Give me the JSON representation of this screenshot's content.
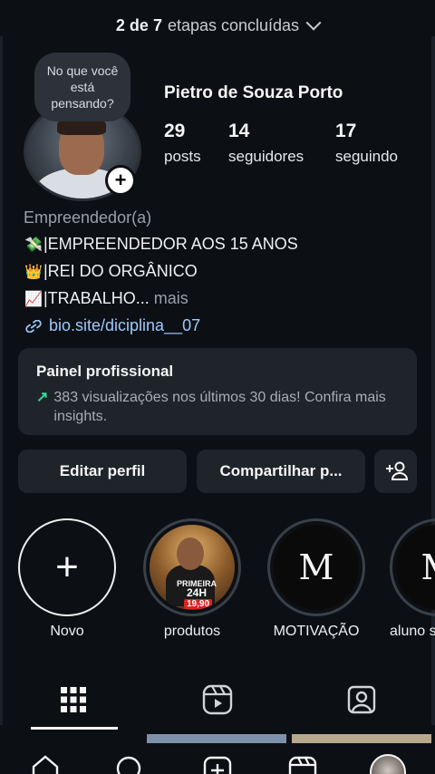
{
  "progress": {
    "done": "2 de 7",
    "rest": "etapas concluídas"
  },
  "profile": {
    "note_bubble": "No que você está pensando?",
    "name": "Pietro de Souza Porto",
    "stats": [
      {
        "value": "29",
        "label": "posts"
      },
      {
        "value": "14",
        "label": "seguidores"
      },
      {
        "value": "17",
        "label": "seguindo"
      }
    ],
    "category": "Empreendedor(a)",
    "bio_lines": [
      {
        "emoji": "💸",
        "text": "|EMPREENDEDOR AOS 15 ANOS"
      },
      {
        "emoji": "👑",
        "text": "|REI DO ORGÂNICO"
      },
      {
        "emoji": "📈",
        "text": "|TRABALHO..."
      }
    ],
    "more": "mais",
    "link": "bio.site/diciplina__07"
  },
  "panel": {
    "title": "Painel profissional",
    "description": "383 visualizações nos últimos 30 dias! Confira mais insights."
  },
  "buttons": {
    "edit": "Editar perfil",
    "share": "Compartilhar p..."
  },
  "highlights": [
    {
      "label": "Novo"
    },
    {
      "label": "produtos",
      "promo_top": "PRIMEIRA",
      "promo_mid": "24H",
      "price": "19,90"
    },
    {
      "label": "MOTIVAÇÃO",
      "glyph": "M"
    },
    {
      "label": "aluno s",
      "glyph": "M"
    }
  ],
  "tabs": [
    "grid-icon",
    "reels-icon",
    "tagged-icon"
  ],
  "bottom_nav": [
    "home-icon",
    "search-icon",
    "create-icon",
    "reels-nav-icon",
    "profile-avatar"
  ],
  "colors": {
    "background": "#0c0f14",
    "card": "#1f242b",
    "link": "#9cc9ff",
    "insight_arrow": "#3dd598"
  }
}
